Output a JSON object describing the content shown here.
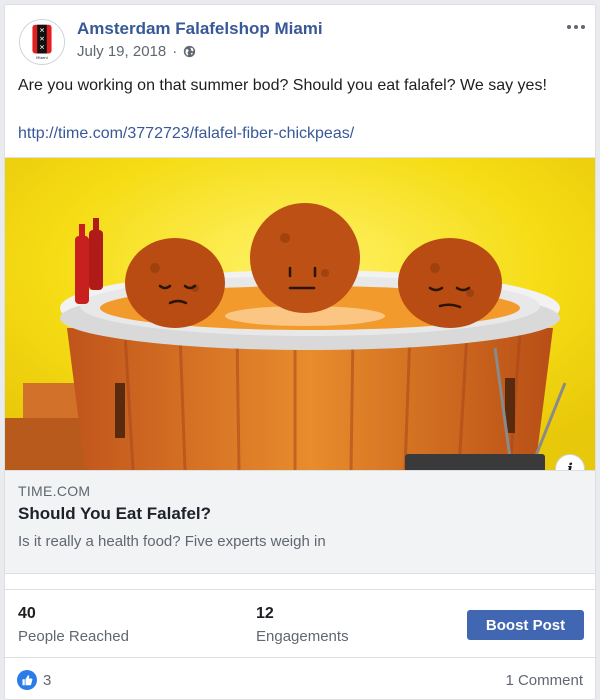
{
  "post": {
    "page_name": "Amsterdam Falafelshop Miami",
    "date": "July 19, 2018",
    "separator": "·",
    "text": "Are you working on that summer bod? Should you eat falafel? We say yes!",
    "link": "http://time.com/3772723/falafel-fiber-chickpeas/"
  },
  "preview": {
    "domain": "TIME.COM",
    "title": "Should You Eat Falafel?",
    "description": "Is it really a health food? Five experts weigh in",
    "info_glyph": "i"
  },
  "insights": {
    "reached_value": "40",
    "reached_label": "People Reached",
    "engagements_value": "12",
    "engagements_label": "Engagements",
    "boost_label": "Boost Post"
  },
  "reactions": {
    "like_count": "3",
    "comments_label": "1 Comment"
  },
  "logo": {
    "crosses": [
      "✕",
      "✕",
      "✕"
    ],
    "caption": "Miami"
  },
  "colors": {
    "page_link": "#385898",
    "boost_button": "#4267b2",
    "like_badge": "#2b7ce9",
    "preview_background": "#f3d611"
  },
  "icons": {
    "privacy": "globe-icon",
    "options": "more-icon",
    "reaction": "like-icon",
    "link_info": "info-icon"
  }
}
